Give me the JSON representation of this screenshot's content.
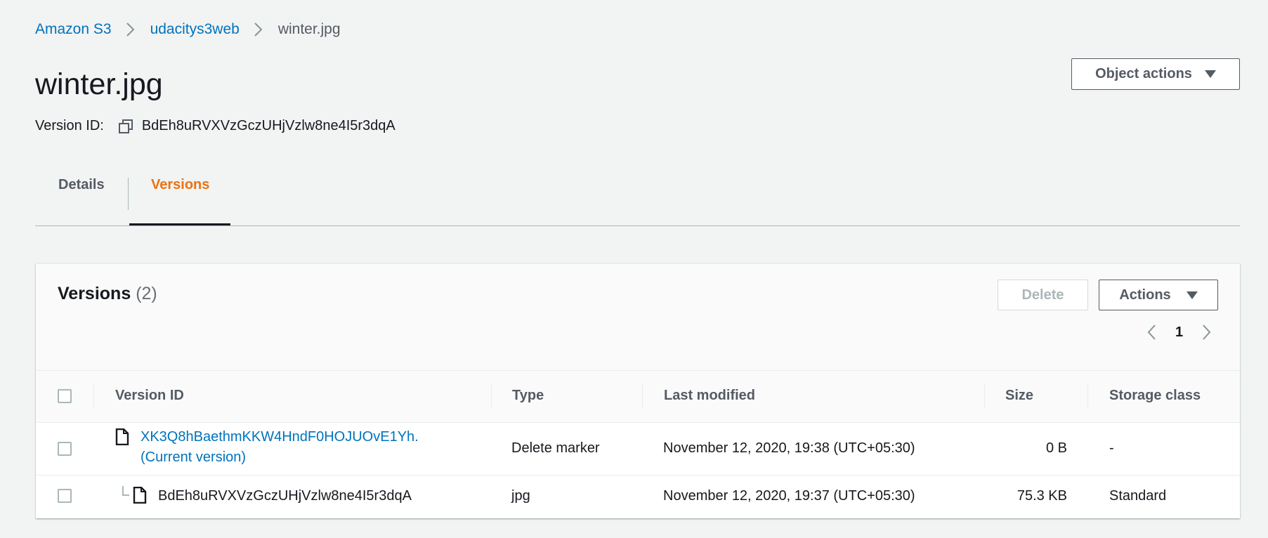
{
  "breadcrumb": {
    "items": [
      "Amazon S3",
      "udacitys3web"
    ],
    "current": "winter.jpg"
  },
  "header": {
    "title": "winter.jpg",
    "object_actions_label": "Object actions",
    "version_id_label": "Version ID:",
    "version_id_value": "BdEh8uRVXVzGczUHjVzlw8ne4I5r3dqA"
  },
  "tabs": [
    {
      "label": "Details",
      "active": false
    },
    {
      "label": "Versions",
      "active": true
    }
  ],
  "versions_panel": {
    "title": "Versions",
    "count": "(2)",
    "delete_label": "Delete",
    "actions_label": "Actions",
    "page_number": "1",
    "columns": [
      "Version ID",
      "Type",
      "Last modified",
      "Size",
      "Storage class"
    ],
    "rows": [
      {
        "version_id": "XK3Q8hBaethmKKW4HndF0HOJUOvE1Yh.",
        "current_label": "(Current version)",
        "type": "Delete marker",
        "last_modified": "November 12, 2020, 19:38 (UTC+05:30)",
        "size": "0 B",
        "storage_class": "-"
      },
      {
        "version_id": "BdEh8uRVXVzGczUHjVzlw8ne4I5r3dqA",
        "type": "jpg",
        "last_modified": "November 12, 2020, 19:37 (UTC+05:30)",
        "size": "75.3 KB",
        "storage_class": "Standard"
      }
    ]
  },
  "colors": {
    "link": "#0073bb",
    "active_tab": "#ec7211",
    "text": "#16191f",
    "secondary_text": "#545b64",
    "background": "#f2f3f3"
  },
  "icons": [
    "chevron-right-icon",
    "copy-icon",
    "caret-down-icon",
    "chevron-left-icon",
    "file-icon"
  ]
}
